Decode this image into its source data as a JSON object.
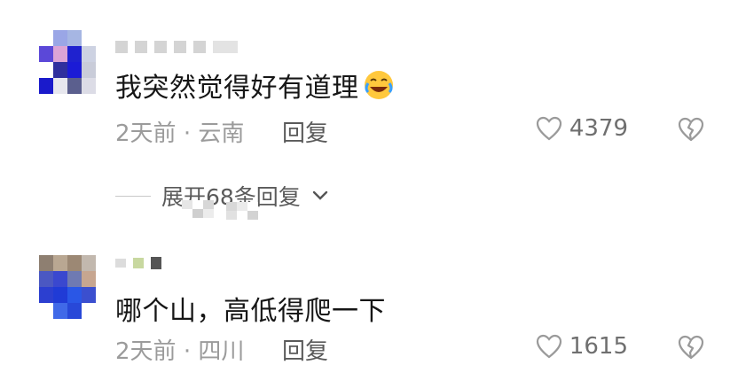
{
  "comments": [
    {
      "text": "我突然觉得好有道理",
      "emoji": "rolling-laughing-emoji",
      "time": "2天前",
      "location": "云南",
      "reply_label": "回复",
      "likes": "4379",
      "expand_label": "展开68条回复"
    },
    {
      "text": "哪个山，高低得爬一下",
      "time": "2天前",
      "location": "四川",
      "reply_label": "回复",
      "likes": "1615"
    }
  ],
  "separator": "·",
  "colors": {
    "text": "#161616",
    "meta": "#9b9b9b",
    "reply": "#5a5a5a",
    "icon": "#9a9a9a"
  },
  "icons": [
    "heart-outline-icon",
    "broken-heart-icon",
    "chevron-down-icon"
  ]
}
